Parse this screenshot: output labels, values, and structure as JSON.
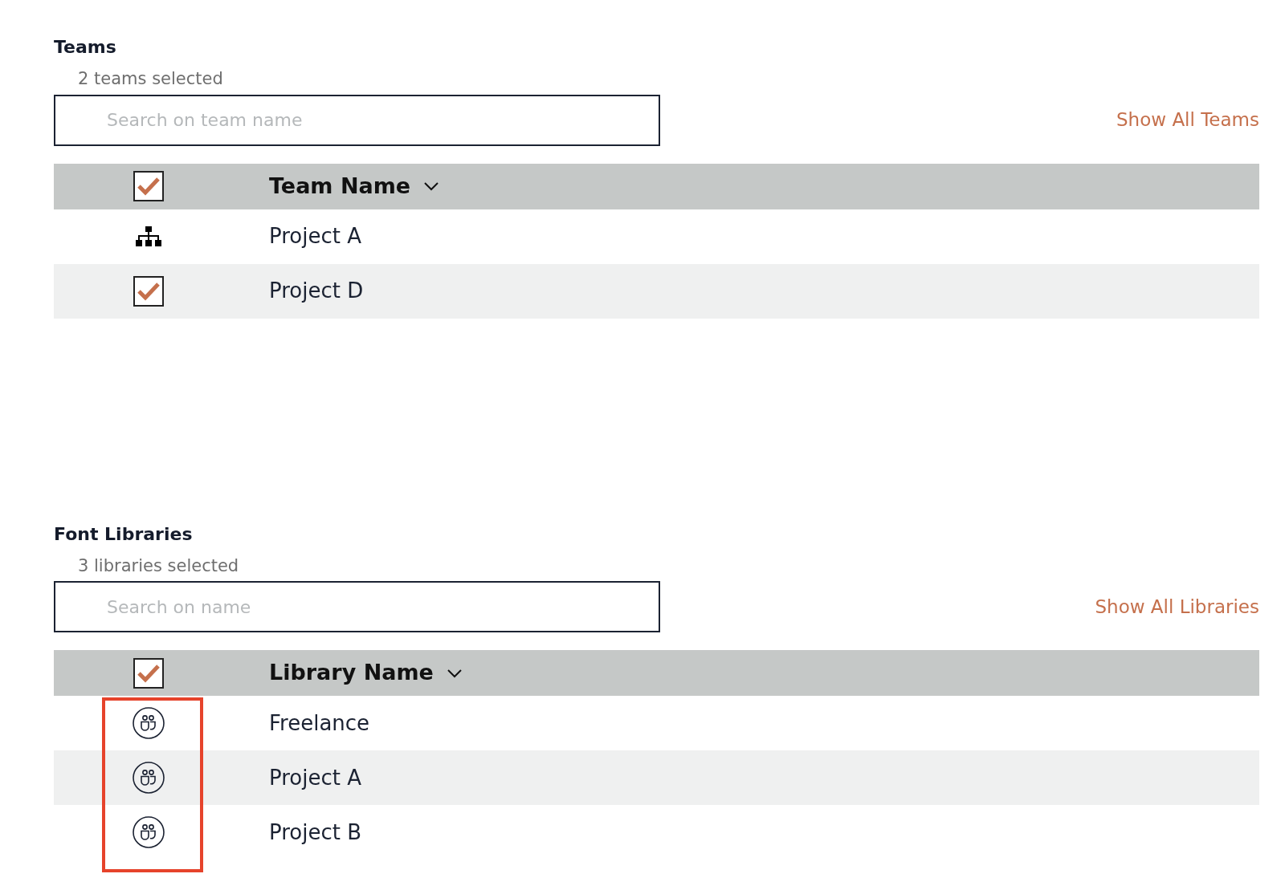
{
  "sections": [
    {
      "title": "Teams",
      "subtitle": "2 teams selected",
      "search": {
        "placeholder": "Search on team name"
      },
      "show_all": "Show All Teams",
      "highlight_icons": false,
      "header": {
        "checked": true,
        "label": "Team Name"
      },
      "rows": [
        {
          "kind": "org",
          "name": "Project A"
        },
        {
          "kind": "checkbox",
          "checked": true,
          "name": "Project D"
        }
      ]
    },
    {
      "title": "Font Libraries",
      "subtitle": "3 libraries selected",
      "search": {
        "placeholder": "Search on name"
      },
      "show_all": "Show All Libraries",
      "highlight_icons": true,
      "header": {
        "checked": true,
        "label": "Library Name"
      },
      "rows": [
        {
          "kind": "group",
          "name": "Freelance"
        },
        {
          "kind": "group",
          "name": "Project A"
        },
        {
          "kind": "group",
          "name": "Project B"
        }
      ]
    }
  ]
}
